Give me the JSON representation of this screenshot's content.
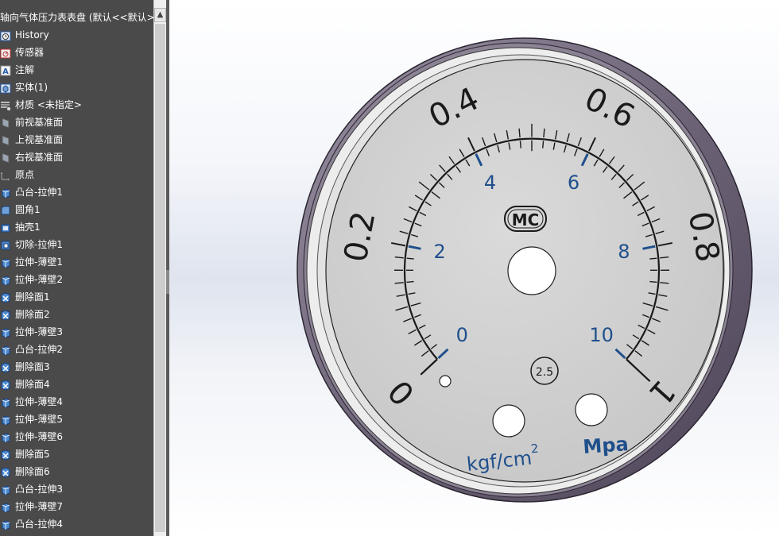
{
  "feature_tree": {
    "title": "轴向气体压力表表盘 (默认<<默认>",
    "items": [
      {
        "label": "History",
        "icon": "history-icon"
      },
      {
        "label": "传感器",
        "icon": "sensor-icon"
      },
      {
        "label": "注解",
        "icon": "annotation-icon"
      },
      {
        "label": "实体(1)",
        "icon": "solid-bodies-icon"
      },
      {
        "label": "材质 <未指定>",
        "icon": "material-icon"
      },
      {
        "label": "前视基准面",
        "icon": "plane-icon"
      },
      {
        "label": "上视基准面",
        "icon": "plane-icon"
      },
      {
        "label": "右视基准面",
        "icon": "plane-icon"
      },
      {
        "label": "原点",
        "icon": "origin-icon"
      },
      {
        "label": "凸台-拉伸1",
        "icon": "extrude-icon"
      },
      {
        "label": "圆角1",
        "icon": "fillet-icon"
      },
      {
        "label": "抽壳1",
        "icon": "shell-icon"
      },
      {
        "label": "切除-拉伸1",
        "icon": "cut-extrude-icon"
      },
      {
        "label": "拉伸-薄壁1",
        "icon": "extrude-icon"
      },
      {
        "label": "拉伸-薄壁2",
        "icon": "extrude-icon"
      },
      {
        "label": "删除面1",
        "icon": "delete-face-icon"
      },
      {
        "label": "删除面2",
        "icon": "delete-face-icon"
      },
      {
        "label": "拉伸-薄壁3",
        "icon": "extrude-icon"
      },
      {
        "label": "凸台-拉伸2",
        "icon": "extrude-icon"
      },
      {
        "label": "删除面3",
        "icon": "delete-face-icon"
      },
      {
        "label": "删除面4",
        "icon": "delete-face-icon"
      },
      {
        "label": "拉伸-薄壁4",
        "icon": "extrude-icon"
      },
      {
        "label": "拉伸-薄壁5",
        "icon": "extrude-icon"
      },
      {
        "label": "拉伸-薄壁6",
        "icon": "extrude-icon"
      },
      {
        "label": "删除面5",
        "icon": "delete-face-icon"
      },
      {
        "label": "删除面6",
        "icon": "delete-face-icon"
      },
      {
        "label": "凸台-拉伸3",
        "icon": "extrude-icon"
      },
      {
        "label": "拉伸-薄壁7",
        "icon": "extrude-icon"
      },
      {
        "label": "凸台-拉伸4",
        "icon": "extrude-icon"
      }
    ]
  },
  "scrollbar": {
    "up_arrow": "▲"
  },
  "gauge": {
    "outer_scale_labels": [
      "0",
      "0.2",
      "0.4",
      "0.6",
      "0.8",
      "1"
    ],
    "inner_scale_labels": [
      "0",
      "2",
      "4",
      "6",
      "8",
      "10"
    ],
    "logo": "MC",
    "accuracy_class": "2.5",
    "unit_kgf": "kgf/cm",
    "unit_kgf_sup": "2",
    "unit_mpa": "Mpa",
    "colors": {
      "dial_face": "#d2d2d2",
      "rim": "#7a7084",
      "rim_dark": "#5e5568",
      "ink_black": "#1a1a1a",
      "ink_blue": "#1f4f8c"
    }
  }
}
